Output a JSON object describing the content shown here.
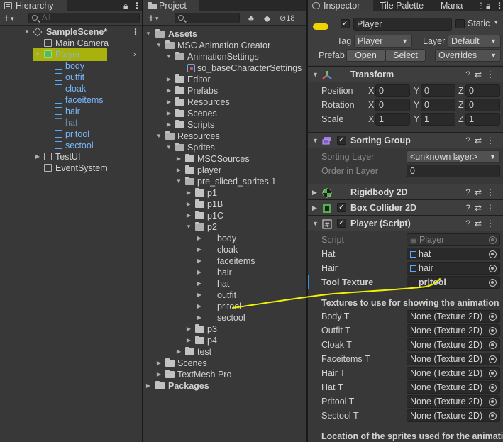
{
  "hierarchy": {
    "tab": "Hierarchy",
    "search_placeholder": "All",
    "items": [
      {
        "label": "SampleScene*"
      },
      {
        "label": "Main Camera"
      },
      {
        "label": "Player"
      },
      {
        "label": "body"
      },
      {
        "label": "outfit"
      },
      {
        "label": "cloak"
      },
      {
        "label": "faceitems"
      },
      {
        "label": "hair"
      },
      {
        "label": "hat"
      },
      {
        "label": "pritool"
      },
      {
        "label": "sectool"
      },
      {
        "label": "TestUI"
      },
      {
        "label": "EventSystem"
      }
    ]
  },
  "project": {
    "tab": "Project",
    "hidden_count": "18",
    "tree": [
      {
        "label": "Assets"
      },
      {
        "label": "MSC Animation Creator"
      },
      {
        "label": "AnimationSettings"
      },
      {
        "label": "so_baseCharacterSettings"
      },
      {
        "label": "Editor"
      },
      {
        "label": "Prefabs"
      },
      {
        "label": "Resources"
      },
      {
        "label": "Scenes"
      },
      {
        "label": "Scripts"
      },
      {
        "label": "Resources"
      },
      {
        "label": "Sprites"
      },
      {
        "label": "MSCSources"
      },
      {
        "label": "player"
      },
      {
        "label": "pre_sliced_sprites 1"
      },
      {
        "label": "p1"
      },
      {
        "label": "p1B"
      },
      {
        "label": "p1C"
      },
      {
        "label": "p2"
      },
      {
        "label": "body"
      },
      {
        "label": "cloak"
      },
      {
        "label": "faceitems"
      },
      {
        "label": "hair"
      },
      {
        "label": "hat"
      },
      {
        "label": "outfit"
      },
      {
        "label": "pritool"
      },
      {
        "label": "sectool"
      },
      {
        "label": "p3"
      },
      {
        "label": "p4"
      },
      {
        "label": "test"
      },
      {
        "label": "Scenes"
      },
      {
        "label": "TextMesh Pro"
      },
      {
        "label": "Packages"
      }
    ]
  },
  "inspector": {
    "tabs": [
      "Inspector",
      "Tile Palette",
      "Mana"
    ],
    "object_name": "Player",
    "static_label": "Static",
    "tag_label": "Tag",
    "tag_value": "Player",
    "layer_label": "Layer",
    "layer_value": "Default",
    "prefab_label": "Prefab",
    "open_label": "Open",
    "select_label": "Select",
    "overrides_label": "Overrides",
    "transform": {
      "title": "Transform",
      "position_label": "Position",
      "rotation_label": "Rotation",
      "scale_label": "Scale",
      "position": [
        "0",
        "0",
        "0"
      ],
      "rotation": [
        "0",
        "0",
        "0"
      ],
      "scale": [
        "1",
        "1",
        "1"
      ],
      "axes": [
        "X",
        "Y",
        "Z"
      ]
    },
    "sorting_group": {
      "title": "Sorting Group",
      "sorting_layer_label": "Sorting Layer",
      "sorting_layer_value": "<unknown layer>",
      "order_label": "Order in Layer",
      "order_value": "0"
    },
    "rigidbody": {
      "title": "Rigidbody 2D"
    },
    "box_collider": {
      "title": "Box Collider 2D"
    },
    "script_comp": {
      "title": "Player (Script)",
      "script_label": "Script",
      "script_value": "Player",
      "hat_label": "Hat",
      "hat_value": "hat",
      "hair_label": "Hair",
      "hair_value": "hair",
      "tool_label": "Tool Texture",
      "tool_value": "pritool",
      "textures_header": "Textures to use for showing the animation",
      "textures": [
        {
          "label": "Body T",
          "value": "None (Texture 2D)"
        },
        {
          "label": "Outfit T",
          "value": "None (Texture 2D)"
        },
        {
          "label": "Cloak T",
          "value": "None (Texture 2D)"
        },
        {
          "label": "Faceitems T",
          "value": "None (Texture 2D)"
        },
        {
          "label": "Hair T",
          "value": "None (Texture 2D)"
        },
        {
          "label": "Hat T",
          "value": "None (Texture 2D)"
        },
        {
          "label": "Pritool T",
          "value": "None (Texture 2D)"
        },
        {
          "label": "Sectool T",
          "value": "None (Texture 2D)"
        }
      ],
      "location_header": "Location of the sprites used for the animati"
    }
  },
  "colors": {
    "selection": "#2c5d87",
    "highlight": "#c9d400",
    "annotation_line": "#f2f200",
    "prefab_blue": "#79b8ff"
  }
}
